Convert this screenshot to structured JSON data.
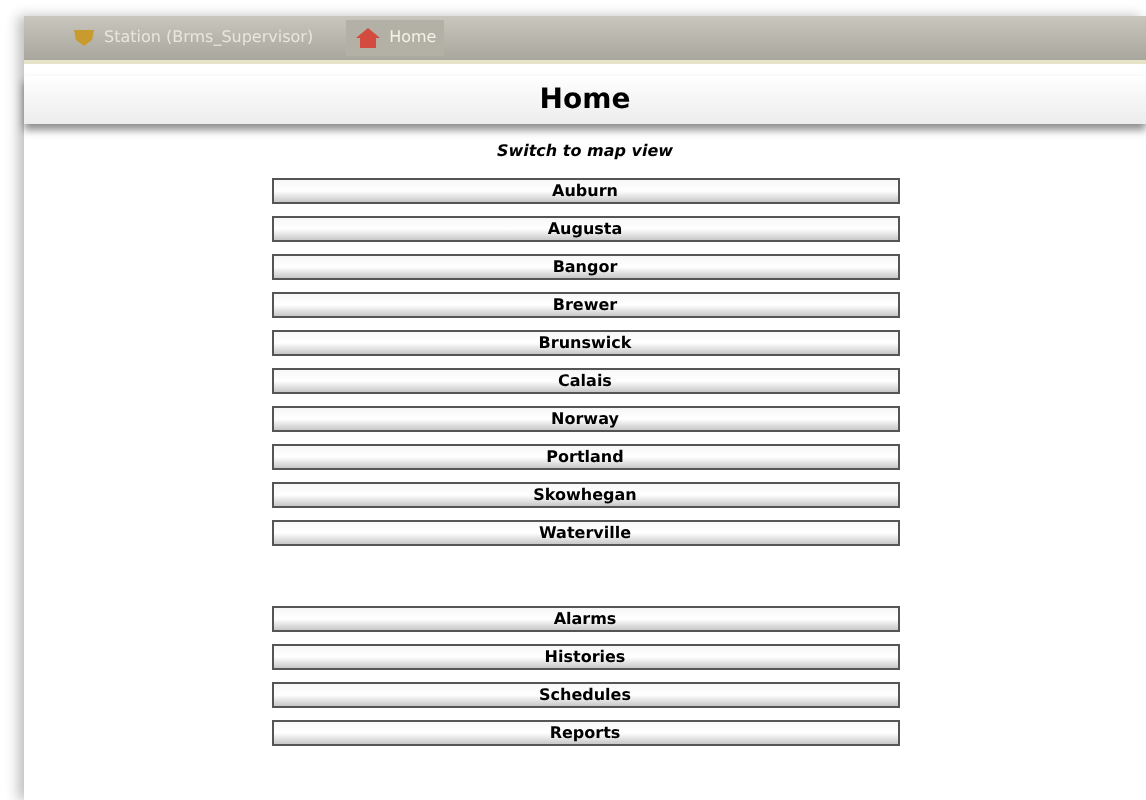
{
  "toolbar": {
    "tabs": [
      {
        "label": "Station (Brms_Supervisor)",
        "kind": "station",
        "selected": false
      },
      {
        "label": "Home",
        "kind": "home",
        "selected": true
      }
    ]
  },
  "page": {
    "title": "Home",
    "map_link": "Switch to map view",
    "groups": [
      [
        "Auburn",
        "Augusta",
        "Bangor",
        "Brewer",
        "Brunswick",
        "Calais",
        "Norway",
        "Portland",
        "Skowhegan",
        "Waterville"
      ],
      [
        "Alarms",
        "Histories",
        "Schedules",
        "Reports"
      ]
    ]
  }
}
